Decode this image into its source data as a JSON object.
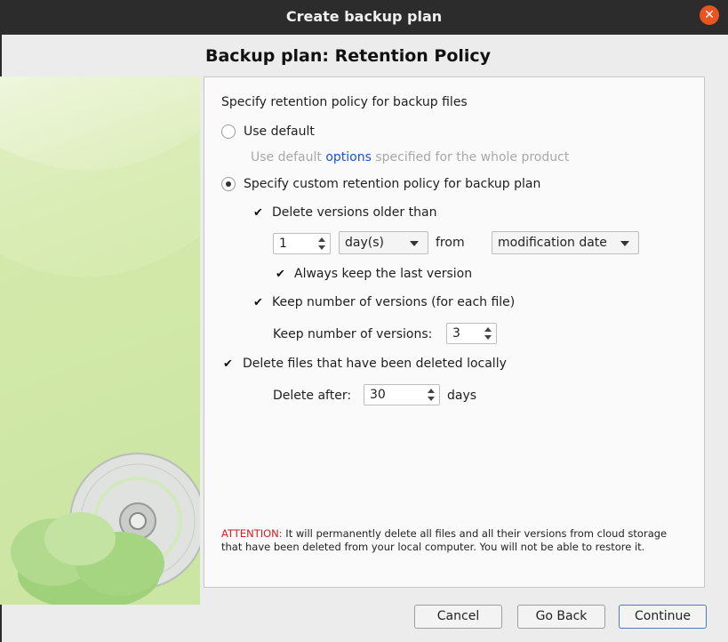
{
  "window": {
    "title": "Create backup plan"
  },
  "page": {
    "heading": "Backup plan: Retention Policy"
  },
  "policy": {
    "intro": "Specify retention policy for backup files",
    "use_default": {
      "label": "Use default",
      "selected": false,
      "hint_prefix": "Use default",
      "hint_link": "options",
      "hint_suffix": "specified for the whole product"
    },
    "custom": {
      "label": "Specify custom retention policy for backup plan",
      "selected": true
    },
    "delete_older": {
      "label": "Delete versions older than",
      "checked": true,
      "amount": "1",
      "unit": "day(s)",
      "from_label": "from",
      "date_basis": "modification date"
    },
    "keep_last": {
      "label": "Always keep the last version",
      "checked": true
    },
    "keep_number": {
      "label": "Keep number of versions (for each file)",
      "checked": true,
      "count_label": "Keep number of versions:",
      "count": "3"
    },
    "delete_local": {
      "label": "Delete files that have been deleted locally",
      "checked": true,
      "after_label": "Delete after:",
      "after_value": "30",
      "after_unit": "days"
    }
  },
  "attention": {
    "prefix": "ATTENTION:",
    "text": "It will permanently delete all files and all their versions from cloud storage that have been deleted from your local computer. You will not be able to restore it."
  },
  "buttons": {
    "cancel": "Cancel",
    "back": "Go Back",
    "continue": "Continue"
  },
  "colors": {
    "titlebar": "#2c2c2c",
    "close": "#e95420",
    "link": "#1a4fd6",
    "attention": "#d21f1f"
  }
}
